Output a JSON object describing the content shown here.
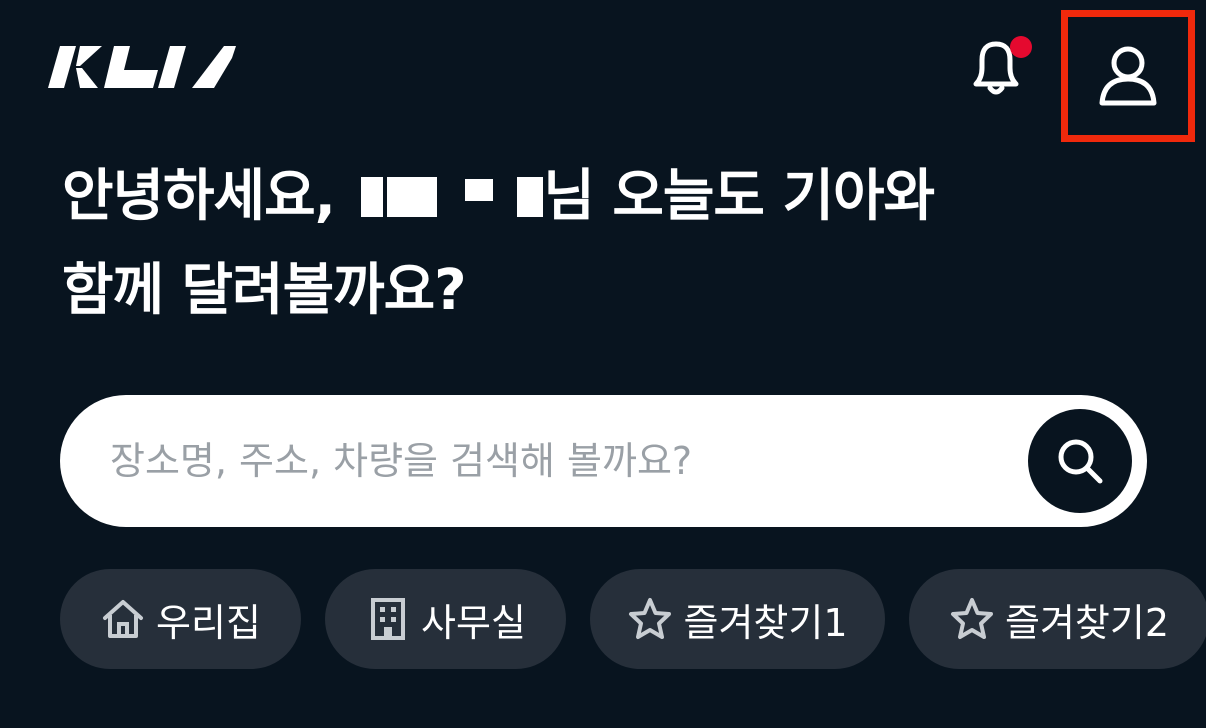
{
  "header": {
    "brand": "KIA",
    "notification_unread": true
  },
  "greeting": {
    "line1_prefix": "안녕하세요,",
    "line1_suffix": "님 오늘도 기아와",
    "line2": "함께 달려볼까요?"
  },
  "search": {
    "placeholder": "장소명, 주소, 차량을 검색해 볼까요?"
  },
  "shortcuts": [
    {
      "label": "우리집",
      "icon": "home-icon"
    },
    {
      "label": "사무실",
      "icon": "building-icon"
    },
    {
      "label": "즐겨찾기1",
      "icon": "star-icon"
    },
    {
      "label": "즐겨찾기2",
      "icon": "star-icon"
    }
  ],
  "colors": {
    "background": "#08141f",
    "chip": "#262f3a",
    "highlight": "#f0290c",
    "notification_dot": "#e5092f"
  }
}
